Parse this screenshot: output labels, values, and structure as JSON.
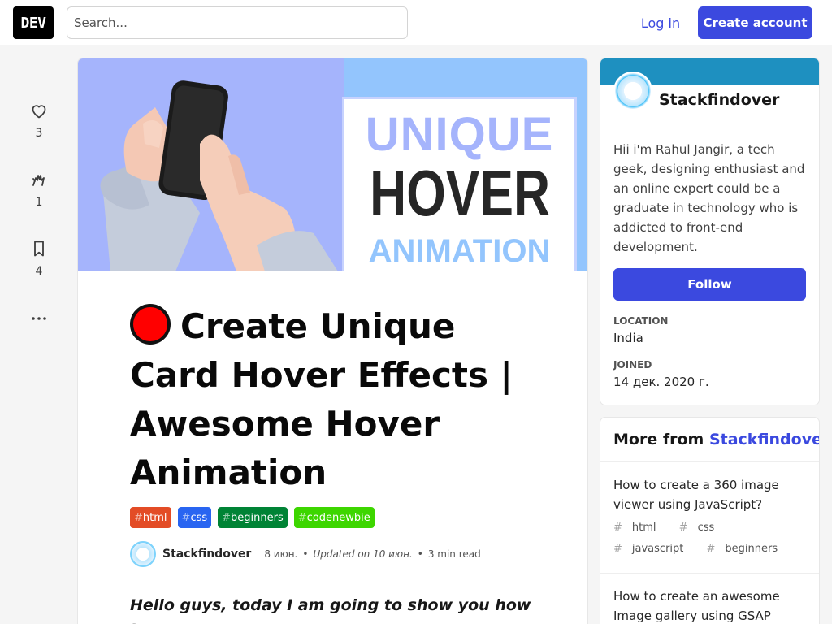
{
  "header": {
    "logo": "DEV",
    "search_placeholder": "Search...",
    "login_label": "Log in",
    "create_account_label": "Create account"
  },
  "reactions": [
    {
      "icon": "heart-icon",
      "count": "3"
    },
    {
      "icon": "unicorn-icon",
      "count": "1"
    },
    {
      "icon": "bookmark-icon",
      "count": "4"
    },
    {
      "icon": "more-icon",
      "count": ""
    }
  ],
  "article": {
    "cover": {
      "line1": "UNIQUE",
      "line2": "HOVER",
      "line3": "ANIMATION"
    },
    "title": "Create Unique Card Hover Effects | Awesome Hover Animation",
    "tags": [
      {
        "hash": "#",
        "name": "html",
        "color": "#e34c26"
      },
      {
        "hash": "#",
        "name": "css",
        "color": "#2965f1"
      },
      {
        "hash": "#",
        "name": "beginners",
        "color": "#008335"
      },
      {
        "hash": "#",
        "name": "codenewbie",
        "color": "#3dd600"
      }
    ],
    "author": "Stackfindover",
    "date": "8 июн.",
    "updated": "Updated on 10 июн.",
    "read_time": "3 min read",
    "body_intro": "Hello guys, today I am going to show you how to"
  },
  "profile": {
    "name": "Stackfindover",
    "bio": "Hii i'm Rahul Jangir, a tech geek, designing enthusiast and an online expert could be a graduate in technology who is addicted to front-end development.",
    "follow_label": "Follow",
    "location_label": "LOCATION",
    "location": "India",
    "joined_label": "JOINED",
    "joined": "14 дек. 2020 г.",
    "brand_color": "#1e90c0"
  },
  "more_from": {
    "prefix": "More from",
    "author": "Stackfindover",
    "items": [
      {
        "title": "How to create a 360 image viewer using JavaScript?",
        "tags": [
          "html",
          "css",
          "javascript",
          "beginners"
        ]
      },
      {
        "title": "How to create an awesome Image gallery using GSAP",
        "tags": []
      }
    ]
  },
  "colors": {
    "accent": "#3b49df",
    "cover_left": "#a5b4fc",
    "cover_right": "#93c5fd"
  }
}
